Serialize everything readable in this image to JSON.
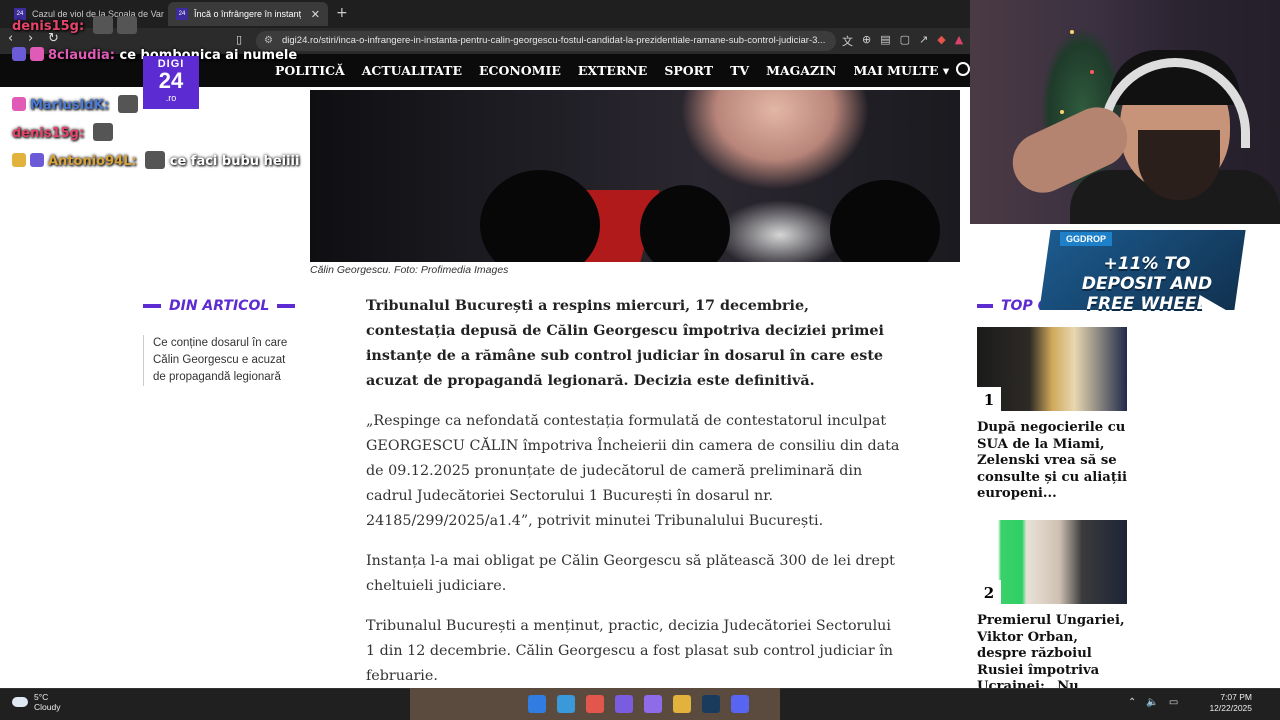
{
  "browser": {
    "tabs": [
      {
        "title": "Cazul de viol de la Școala de Vară Ai",
        "active": false
      },
      {
        "title": "Încă o înfrângere în instanță pen",
        "active": true
      }
    ],
    "new_tab": "+",
    "close": "✕",
    "url": "digi24.ro/stiri/inca-o-infrangere-in-instanta-pentru-calin-georgescu-fostul-candidat-la-prezidentiale-ramane-sub-control-judiciar-3..."
  },
  "site": {
    "logo": {
      "line1": "DIGI",
      "line2": "24",
      "line3": ".ro"
    },
    "nav": [
      "POLITICĂ",
      "ACTUALITATE",
      "ECONOMIE",
      "EXTERNE",
      "SPORT",
      "TV",
      "MAGAZIN",
      "MAI MULTE"
    ],
    "nav_more_chevron": "▾"
  },
  "article": {
    "caption": "Călin Georgescu. Foto: Profimedia Images",
    "lead": "Tribunalul București a respins miercuri, 17 decembrie, contestația depusă de Călin Georgescu împotriva deciziei primei instanțe de a rămâne sub control judiciar în dosarul în care este acuzat de propagandă legionară. Decizia este definitivă.",
    "paragraphs": [
      "„Respinge ca nefondată contestația formulată de contestatorul inculpat GEORGESCU CĂLIN împotriva Încheierii din camera de consiliu din data de 09.12.2025 pronunțate de judecătorul de cameră preliminară din cadrul Judecătoriei Sectorului 1 București în dosarul nr. 24185/299/2025/a1.4”, potrivit minutei Tribunalului București.",
      "Instanța l-a mai obligat pe Călin Georgescu să plătească 300 de lei drept cheltuieli judiciare.",
      "Tribunalul București a menținut, practic, decizia Judecătoriei Sectorului 1 din 12 decembrie. Călin Georgescu a fost plasat sub control judiciar în februarie."
    ]
  },
  "din_articol": {
    "title": "DIN ARTICOL",
    "link": "Ce conține dosarul în care Călin Georgescu e acuzat de propagandă legionară"
  },
  "top_citite": {
    "title": "TOP CITITE",
    "items": [
      {
        "rank": "1",
        "text": "După negocierile cu SUA de la Miami, Zelenski vrea să se consulte și cu aliații europeni..."
      },
      {
        "rank": "2",
        "text": "Premierul Ungariei, Viktor Orban, despre războiul Rusiei împotriva Ucrainei: „Nu este..."
      }
    ]
  },
  "promo": {
    "tag": "GGDROP",
    "text": "+11% TO DEPOSIT AND FREE WHEEL"
  },
  "chat": [
    {
      "user": "denis15g:",
      "message": "",
      "color": "user"
    },
    {
      "user": "8claudia:",
      "message": "ce bombonica ai numele",
      "color": "pink"
    },
    {
      "user": "MariusIdK:",
      "message": "",
      "color": "blue"
    },
    {
      "user": "denis15g:",
      "message": "",
      "color": "user"
    },
    {
      "user": "Antonio94L:",
      "message": "ce faci bubu heiiii",
      "color": "gold"
    }
  ],
  "taskbar": {
    "temp": "5°C",
    "weather": "Cloudy",
    "time": "7:07 PM",
    "date": "12/22/2025",
    "app_colors": [
      "#2f7de1",
      "#3a9ad9",
      "#e3564b",
      "#7a5ce0",
      "#8e6be8",
      "#e1b33c",
      "#1b3b5c",
      "#5865f2"
    ]
  }
}
